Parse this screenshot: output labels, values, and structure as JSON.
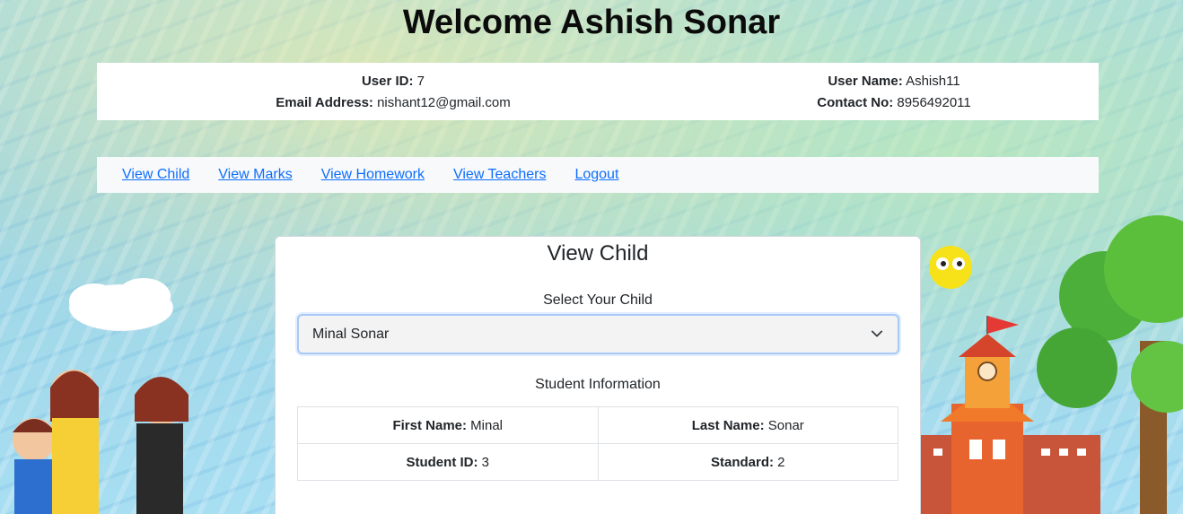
{
  "header": {
    "welcome": "Welcome Ashish Sonar"
  },
  "user_info": {
    "user_id_label": "User ID:",
    "user_id": "7",
    "email_label": "Email Address:",
    "email": "nishant12@gmail.com",
    "user_name_label": "User Name:",
    "user_name": "Ashish11",
    "contact_label": "Contact No:",
    "contact": "8956492011"
  },
  "nav": {
    "items": [
      {
        "label": "View Child"
      },
      {
        "label": "View Marks"
      },
      {
        "label": "View Homework"
      },
      {
        "label": "View Teachers"
      },
      {
        "label": "Logout"
      }
    ]
  },
  "card": {
    "title": "View Child",
    "select_label": "Select Your Child",
    "selected_child": "Minal Sonar",
    "info_title": "Student Information",
    "first_name_label": "First Name:",
    "first_name": "Minal",
    "last_name_label": "Last Name:",
    "last_name": "Sonar",
    "student_id_label": "Student ID:",
    "student_id": "3",
    "standard_label": "Standard:",
    "standard": "2"
  },
  "colors": {
    "link": "#0d6efd",
    "bar_bg": "#f8f9fa",
    "select_focus": "#a9c9f5"
  }
}
